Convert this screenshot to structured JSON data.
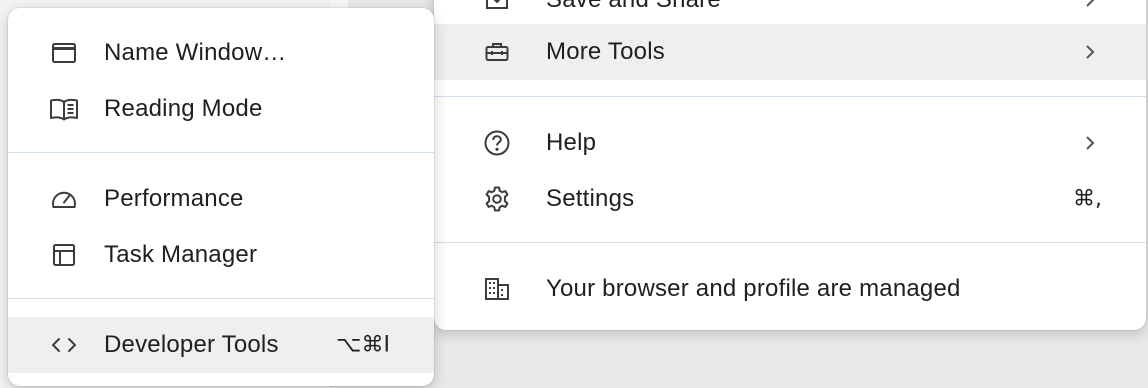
{
  "main_menu": {
    "items": [
      {
        "label": "Save and Share",
        "icon": "save-share-icon",
        "has_submenu": true
      },
      {
        "label": "More Tools",
        "icon": "toolbox-icon",
        "has_submenu": true,
        "highlighted": true
      },
      {
        "label": "Help",
        "icon": "help-circle-icon",
        "has_submenu": true
      },
      {
        "label": "Settings",
        "icon": "gear-icon",
        "shortcut": "⌘,"
      },
      {
        "label": "Your browser and profile are managed",
        "icon": "building-icon"
      }
    ]
  },
  "more_tools_submenu": {
    "items": [
      {
        "label": "Name Window…",
        "icon": "window-icon"
      },
      {
        "label": "Reading Mode",
        "icon": "book-icon"
      },
      {
        "label": "Performance",
        "icon": "gauge-icon"
      },
      {
        "label": "Task Manager",
        "icon": "task-manager-icon"
      },
      {
        "label": "Developer Tools",
        "icon": "code-icon",
        "shortcut": "⌥⌘I",
        "highlighted": true
      }
    ]
  }
}
